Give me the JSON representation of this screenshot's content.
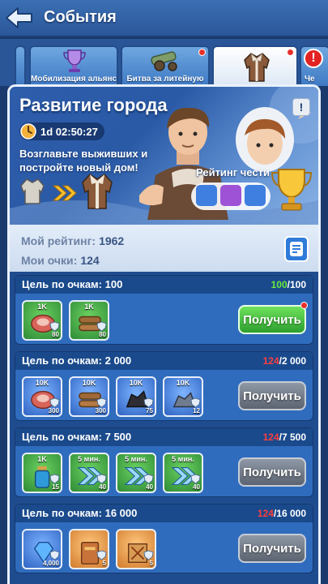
{
  "header": {
    "title": "События"
  },
  "tabs": [
    {
      "label": "Мобилизация альянса",
      "active": false,
      "dot": false
    },
    {
      "label": "Битва за литейную",
      "active": false,
      "dot": true
    },
    {
      "label": "",
      "active": true,
      "dot": true
    },
    {
      "label": "Че",
      "active": false,
      "dot": false
    }
  ],
  "banner": {
    "title": "Развитие города",
    "timer": "1d 02:50:27",
    "description": "Возглавьте выживших и постройте новый дом!",
    "honor_label": "Рейтинг чести"
  },
  "stats": {
    "rating_label": "Мой рейтинг:",
    "rating_value": "1962",
    "points_label": "Мои очки:",
    "points_value": "124"
  },
  "goals": [
    {
      "label": "Цель по очкам: 100",
      "current": "100",
      "target": "/100",
      "status": "green",
      "button": "Получить",
      "button_state": "active",
      "items": [
        {
          "top": "1K",
          "count": "80",
          "icon": "meat-icon",
          "frame": "green"
        },
        {
          "top": "1K",
          "count": "80",
          "icon": "wood-icon",
          "frame": "green"
        }
      ]
    },
    {
      "label": "Цель по очкам: 2 000",
      "current": "124",
      "target": "/2 000",
      "status": "red",
      "button": "Получить",
      "button_state": "disabled",
      "items": [
        {
          "top": "10K",
          "count": "300",
          "icon": "meat-icon",
          "frame": "blue"
        },
        {
          "top": "10K",
          "count": "300",
          "icon": "wood-icon",
          "frame": "blue"
        },
        {
          "top": "10K",
          "count": "75",
          "icon": "coal-icon",
          "frame": "blue"
        },
        {
          "top": "10K",
          "count": "12",
          "icon": "iron-icon",
          "frame": "blue"
        }
      ]
    },
    {
      "label": "Цель по очкам: 7 500",
      "current": "124",
      "target": "/7 500",
      "status": "red",
      "button": "Получить",
      "button_state": "disabled",
      "items": [
        {
          "top": "1K",
          "count": "15",
          "icon": "exp-bottle-icon",
          "frame": "green"
        },
        {
          "top": "5 мин.",
          "count": "40",
          "icon": "speedup-icon",
          "frame": "green"
        },
        {
          "top": "5 мин.",
          "count": "40",
          "icon": "speedup-icon",
          "frame": "green"
        },
        {
          "top": "5 мин.",
          "count": "40",
          "icon": "speedup-icon",
          "frame": "green"
        }
      ]
    },
    {
      "label": "Цель по очкам: 16 000",
      "current": "124",
      "target": "/16 000",
      "status": "red",
      "button": "Получить",
      "button_state": "disabled",
      "items": [
        {
          "top": "",
          "count": "4,000",
          "icon": "gem-icon",
          "frame": "blue"
        },
        {
          "top": "",
          "count": "5",
          "icon": "book-icon",
          "frame": "orange"
        },
        {
          "top": "",
          "count": "5",
          "icon": "scroll-icon",
          "frame": "orange"
        }
      ]
    }
  ]
}
